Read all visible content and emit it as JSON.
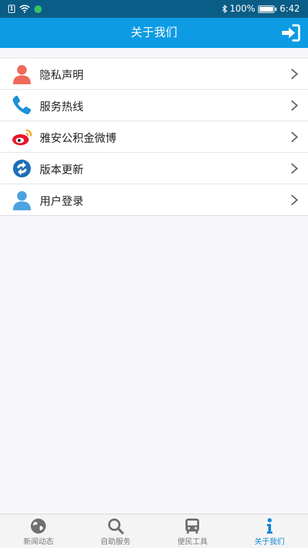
{
  "status_bar": {
    "battery": "100%",
    "time": "6:42",
    "battery_level": 1.0
  },
  "header": {
    "title": "关于我们"
  },
  "menu": {
    "items": [
      {
        "label": "隐私声明",
        "icon": "person-icon"
      },
      {
        "label": "服务热线",
        "icon": "phone-icon"
      },
      {
        "label": "雅安公积金微博",
        "icon": "weibo-icon"
      },
      {
        "label": "版本更新",
        "icon": "update-icon"
      },
      {
        "label": "用户登录",
        "icon": "user-icon"
      }
    ]
  },
  "tabs": [
    {
      "label": "新闻动态",
      "icon": "globe-icon",
      "active": false
    },
    {
      "label": "自助服务",
      "icon": "search-icon",
      "active": false
    },
    {
      "label": "便民工具",
      "icon": "bus-icon",
      "active": false
    },
    {
      "label": "关于我们",
      "icon": "info-icon",
      "active": true
    }
  ],
  "colors": {
    "status_bar": "#0a5d86",
    "header": "#0d9be4",
    "active_tab": "#1486d6",
    "inactive_tab": "#7a7a7a"
  }
}
